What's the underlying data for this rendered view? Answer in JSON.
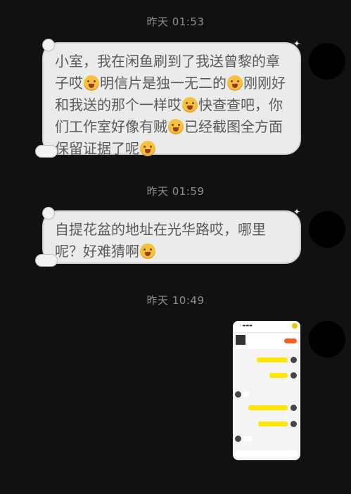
{
  "chat": {
    "messages": [
      {
        "time": "昨天 01:53",
        "text": [
          "小室，我在闲鱼刷到了我送曾黎的章子哎",
          "明信片是独一无二的",
          "刚刚好和我送的那个一样哎",
          "快查查吧，你们工作室好像有贼",
          "已经截图全方面保留证据了呢",
          ""
        ]
      },
      {
        "time": "昨天 01:59",
        "text": [
          "自提花盆的地址在光华路哎，哪里呢？好难猜啊",
          ""
        ]
      },
      {
        "time": "昨天 10:49",
        "image": "screenshot-thumbnail"
      }
    ]
  },
  "icons": {
    "emoji": "fearful-face-emoji",
    "avatar": "avatar-icon"
  },
  "colors": {
    "background": "#111111",
    "bubble": "#ebebeb",
    "accent_yellow": "#ffe500"
  }
}
